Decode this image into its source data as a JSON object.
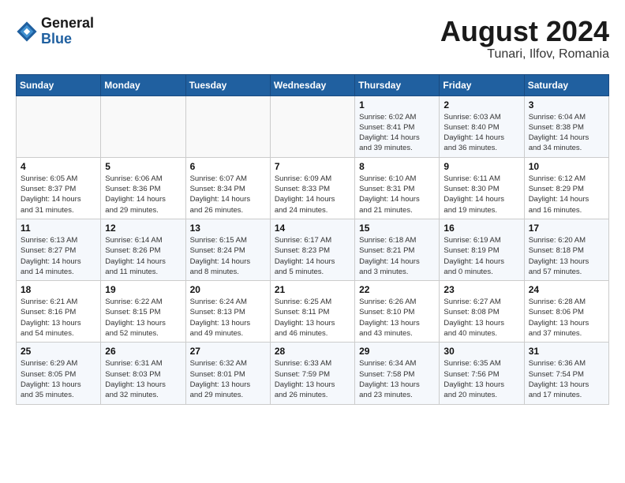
{
  "header": {
    "logo_general": "General",
    "logo_blue": "Blue",
    "title": "August 2024",
    "subtitle": "Tunari, Ilfov, Romania"
  },
  "days_of_week": [
    "Sunday",
    "Monday",
    "Tuesday",
    "Wednesday",
    "Thursday",
    "Friday",
    "Saturday"
  ],
  "weeks": [
    [
      {
        "day": "",
        "detail": ""
      },
      {
        "day": "",
        "detail": ""
      },
      {
        "day": "",
        "detail": ""
      },
      {
        "day": "",
        "detail": ""
      },
      {
        "day": "1",
        "detail": "Sunrise: 6:02 AM\nSunset: 8:41 PM\nDaylight: 14 hours\nand 39 minutes."
      },
      {
        "day": "2",
        "detail": "Sunrise: 6:03 AM\nSunset: 8:40 PM\nDaylight: 14 hours\nand 36 minutes."
      },
      {
        "day": "3",
        "detail": "Sunrise: 6:04 AM\nSunset: 8:38 PM\nDaylight: 14 hours\nand 34 minutes."
      }
    ],
    [
      {
        "day": "4",
        "detail": "Sunrise: 6:05 AM\nSunset: 8:37 PM\nDaylight: 14 hours\nand 31 minutes."
      },
      {
        "day": "5",
        "detail": "Sunrise: 6:06 AM\nSunset: 8:36 PM\nDaylight: 14 hours\nand 29 minutes."
      },
      {
        "day": "6",
        "detail": "Sunrise: 6:07 AM\nSunset: 8:34 PM\nDaylight: 14 hours\nand 26 minutes."
      },
      {
        "day": "7",
        "detail": "Sunrise: 6:09 AM\nSunset: 8:33 PM\nDaylight: 14 hours\nand 24 minutes."
      },
      {
        "day": "8",
        "detail": "Sunrise: 6:10 AM\nSunset: 8:31 PM\nDaylight: 14 hours\nand 21 minutes."
      },
      {
        "day": "9",
        "detail": "Sunrise: 6:11 AM\nSunset: 8:30 PM\nDaylight: 14 hours\nand 19 minutes."
      },
      {
        "day": "10",
        "detail": "Sunrise: 6:12 AM\nSunset: 8:29 PM\nDaylight: 14 hours\nand 16 minutes."
      }
    ],
    [
      {
        "day": "11",
        "detail": "Sunrise: 6:13 AM\nSunset: 8:27 PM\nDaylight: 14 hours\nand 14 minutes."
      },
      {
        "day": "12",
        "detail": "Sunrise: 6:14 AM\nSunset: 8:26 PM\nDaylight: 14 hours\nand 11 minutes."
      },
      {
        "day": "13",
        "detail": "Sunrise: 6:15 AM\nSunset: 8:24 PM\nDaylight: 14 hours\nand 8 minutes."
      },
      {
        "day": "14",
        "detail": "Sunrise: 6:17 AM\nSunset: 8:23 PM\nDaylight: 14 hours\nand 5 minutes."
      },
      {
        "day": "15",
        "detail": "Sunrise: 6:18 AM\nSunset: 8:21 PM\nDaylight: 14 hours\nand 3 minutes."
      },
      {
        "day": "16",
        "detail": "Sunrise: 6:19 AM\nSunset: 8:19 PM\nDaylight: 14 hours\nand 0 minutes."
      },
      {
        "day": "17",
        "detail": "Sunrise: 6:20 AM\nSunset: 8:18 PM\nDaylight: 13 hours\nand 57 minutes."
      }
    ],
    [
      {
        "day": "18",
        "detail": "Sunrise: 6:21 AM\nSunset: 8:16 PM\nDaylight: 13 hours\nand 54 minutes."
      },
      {
        "day": "19",
        "detail": "Sunrise: 6:22 AM\nSunset: 8:15 PM\nDaylight: 13 hours\nand 52 minutes."
      },
      {
        "day": "20",
        "detail": "Sunrise: 6:24 AM\nSunset: 8:13 PM\nDaylight: 13 hours\nand 49 minutes."
      },
      {
        "day": "21",
        "detail": "Sunrise: 6:25 AM\nSunset: 8:11 PM\nDaylight: 13 hours\nand 46 minutes."
      },
      {
        "day": "22",
        "detail": "Sunrise: 6:26 AM\nSunset: 8:10 PM\nDaylight: 13 hours\nand 43 minutes."
      },
      {
        "day": "23",
        "detail": "Sunrise: 6:27 AM\nSunset: 8:08 PM\nDaylight: 13 hours\nand 40 minutes."
      },
      {
        "day": "24",
        "detail": "Sunrise: 6:28 AM\nSunset: 8:06 PM\nDaylight: 13 hours\nand 37 minutes."
      }
    ],
    [
      {
        "day": "25",
        "detail": "Sunrise: 6:29 AM\nSunset: 8:05 PM\nDaylight: 13 hours\nand 35 minutes."
      },
      {
        "day": "26",
        "detail": "Sunrise: 6:31 AM\nSunset: 8:03 PM\nDaylight: 13 hours\nand 32 minutes."
      },
      {
        "day": "27",
        "detail": "Sunrise: 6:32 AM\nSunset: 8:01 PM\nDaylight: 13 hours\nand 29 minutes."
      },
      {
        "day": "28",
        "detail": "Sunrise: 6:33 AM\nSunset: 7:59 PM\nDaylight: 13 hours\nand 26 minutes."
      },
      {
        "day": "29",
        "detail": "Sunrise: 6:34 AM\nSunset: 7:58 PM\nDaylight: 13 hours\nand 23 minutes."
      },
      {
        "day": "30",
        "detail": "Sunrise: 6:35 AM\nSunset: 7:56 PM\nDaylight: 13 hours\nand 20 minutes."
      },
      {
        "day": "31",
        "detail": "Sunrise: 6:36 AM\nSunset: 7:54 PM\nDaylight: 13 hours\nand 17 minutes."
      }
    ]
  ]
}
